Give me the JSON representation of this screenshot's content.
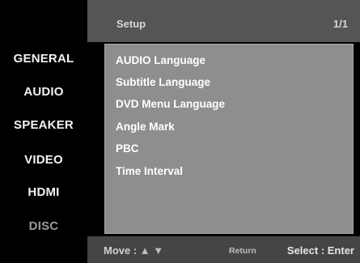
{
  "sidebar": {
    "items": [
      {
        "label": "GENERAL"
      },
      {
        "label": "AUDIO"
      },
      {
        "label": "SPEAKER"
      },
      {
        "label": "VIDEO"
      },
      {
        "label": "HDMI"
      },
      {
        "label": "DISC"
      }
    ]
  },
  "header": {
    "title": "Setup",
    "page_indicator": "1/1"
  },
  "menu": {
    "options": [
      {
        "label": "AUDIO Language"
      },
      {
        "label": "Subtitle Language"
      },
      {
        "label": "DVD Menu Language"
      },
      {
        "label": "Angle Mark"
      },
      {
        "label": "PBC"
      },
      {
        "label": "Time Interval"
      }
    ]
  },
  "footer": {
    "move_label": "Move :",
    "up_arrow": "▲",
    "down_arrow": "▼",
    "return_label": "Return",
    "select_label": "Select : Enter"
  },
  "colors": {
    "background": "#000000",
    "header": "#555555",
    "panel": "#8e8e8e",
    "footer": "#454545",
    "active_text": "#f2f2f2",
    "dim_text": "#9a9a9a"
  },
  "icons": {
    "up": "up-triangle-icon",
    "down": "down-triangle-icon"
  }
}
